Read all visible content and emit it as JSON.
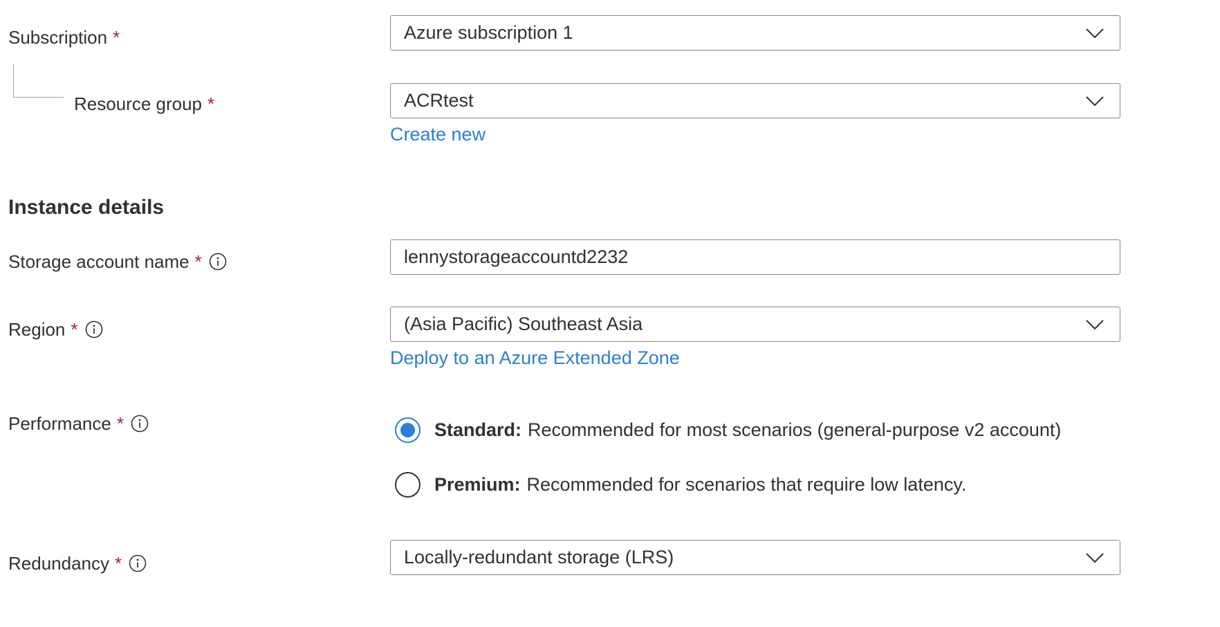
{
  "project_details": {
    "subscription": {
      "label": "Subscription",
      "required_mark": "*",
      "value": "Azure subscription 1"
    },
    "resource_group": {
      "label": "Resource group",
      "required_mark": "*",
      "value": "ACRtest",
      "create_new_link": "Create new"
    }
  },
  "instance_details": {
    "title": "Instance details",
    "storage_account_name": {
      "label": "Storage account name",
      "required_mark": "*",
      "value": "lennystorageaccountd2232",
      "icon": "info-icon"
    },
    "region": {
      "label": "Region",
      "required_mark": "*",
      "value": "(Asia Pacific) Southeast Asia",
      "icon": "info-icon",
      "extended_zone_link": "Deploy to an Azure Extended Zone"
    },
    "performance": {
      "label": "Performance",
      "required_mark": "*",
      "icon": "info-icon",
      "selected": "standard",
      "options": [
        {
          "title": "Standard:",
          "description": "Recommended for most scenarios (general-purpose v2 account)",
          "checked": true
        },
        {
          "title": "Premium:",
          "description": "Recommended for scenarios that require low latency.",
          "checked": false
        }
      ]
    },
    "redundancy": {
      "label": "Redundancy",
      "required_mark": "*",
      "icon": "info-icon",
      "value": "Locally-redundant storage (LRS)"
    }
  },
  "colors": {
    "accent": "#2b7fd4",
    "required": "#a4262c",
    "text": "#323130",
    "border": "#8a8886"
  }
}
